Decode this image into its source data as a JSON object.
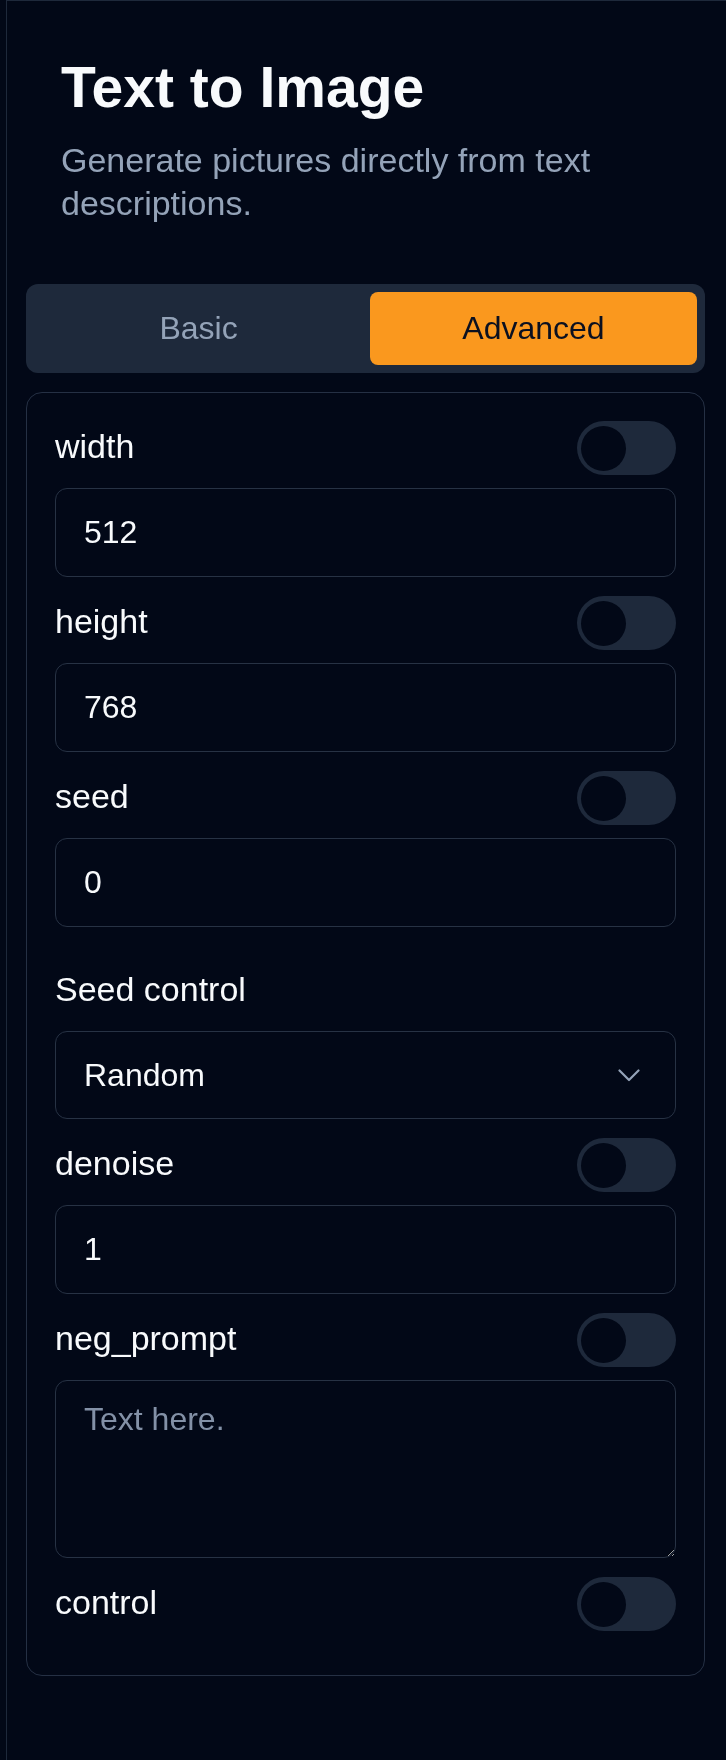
{
  "header": {
    "title": "Text to Image",
    "subtitle": "Generate pictures directly from text descriptions."
  },
  "tabs": [
    {
      "label": "Basic",
      "selected": false
    },
    {
      "label": "Advanced",
      "selected": true
    }
  ],
  "fields": [
    {
      "kind": "number",
      "label": "width",
      "on": false,
      "value": "512"
    },
    {
      "kind": "number",
      "label": "height",
      "on": false,
      "value": "768"
    },
    {
      "kind": "number",
      "label": "seed",
      "on": false,
      "value": "0"
    },
    {
      "kind": "select",
      "label": "Seed control",
      "value": "Random"
    },
    {
      "kind": "number",
      "label": "denoise",
      "on": false,
      "value": "1"
    },
    {
      "kind": "textarea",
      "label": "neg_prompt",
      "on": false,
      "placeholder": "Text here."
    },
    {
      "kind": "toggle",
      "label": "control",
      "on": false
    }
  ]
}
